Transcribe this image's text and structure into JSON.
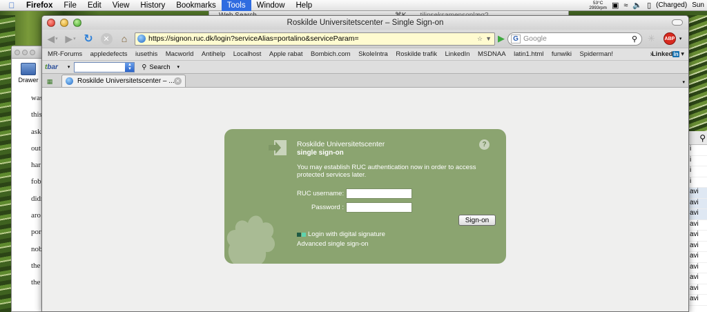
{
  "menubar": {
    "items": [
      "Firefox",
      "File",
      "Edit",
      "View",
      "History",
      "Bookmarks",
      "Tools",
      "Window",
      "Help"
    ],
    "active_item": "Tools",
    "temp": "53°C",
    "rpm": "2993rpm",
    "battery": "(Charged)",
    "clock": "Sun"
  },
  "background": {
    "top_window_title": "Web Search",
    "top_window_shortcut": "⌘K",
    "top_window_extra": "tilinseksamensoplæg?",
    "left_window_drawer": "Drawer",
    "left_window_text": [
      "was",
      "this",
      "ask",
      "out",
      "har",
      "",
      "fob",
      "didn",
      "aro",
      "por",
      "nob",
      "the",
      "the"
    ],
    "right_window_rows": [
      "i",
      "i",
      "i",
      "i",
      "avi",
      "avi",
      "avi",
      "avi",
      "avi",
      "avi",
      "avi",
      "avi",
      "avi",
      "avi",
      "avi"
    ]
  },
  "window": {
    "title": "Roskilde Universitetscenter – Single Sign-on"
  },
  "navbar": {
    "url": "https://signon.ruc.dk/login?serviceAlias=portalino&serviceParam=",
    "search_placeholder": "Google",
    "search_engine_letter": "G",
    "abp_label": "ABP"
  },
  "bookmarks": {
    "items": [
      "MR-Forums",
      "appledefects",
      "iusethis",
      "Macworld",
      "Antihelp",
      "Localhost",
      "Apple rabat",
      "Bombich.com",
      "SkoleIntra",
      "Roskilde trafik",
      "LinkedIn",
      "MSDNAA",
      "latin1.html",
      "funwiki",
      "Spiderman!"
    ],
    "more": "»",
    "linkedin_prefix": "Linked",
    "linkedin_suffix": "in"
  },
  "tbar": {
    "logo_prefix": "t",
    "logo_suffix": "bar",
    "search_label": "Search"
  },
  "tabs": {
    "active_label": "Roskilde Universitetscenter – ..."
  },
  "sso": {
    "org_name": "Roskilde Universitetscenter",
    "title": "single sign-on",
    "info": "You may establish RUC authentication now in order to access protected services later.",
    "username_label": "RUC username:",
    "password_label": "Password :",
    "signon_button": "Sign-on",
    "digital_signature_link": "Login with digital signature",
    "advanced_link": "Advanced single sign-on",
    "help": "?",
    "panel_color": "#8ba470"
  }
}
